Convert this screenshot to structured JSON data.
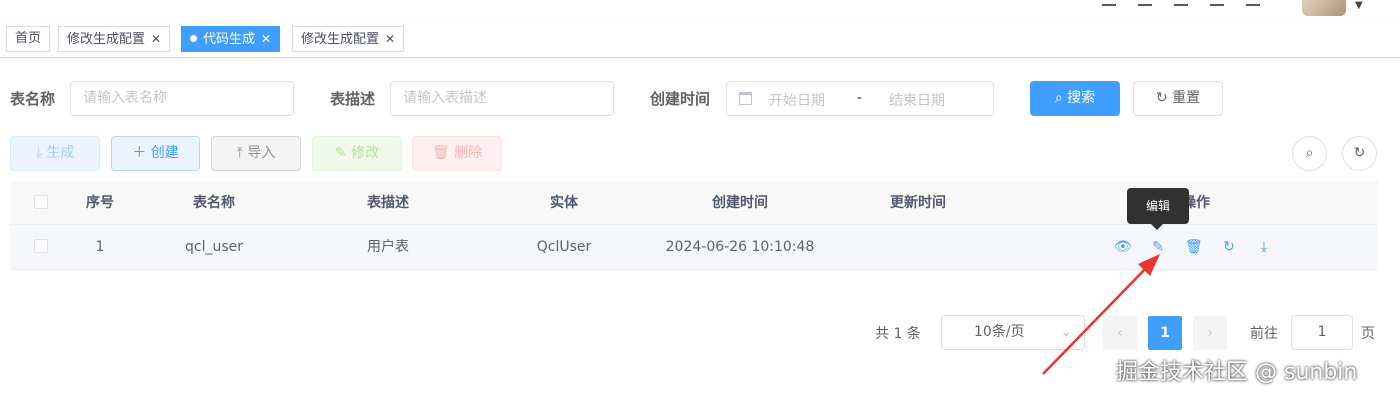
{
  "tags": [
    {
      "label": "首页",
      "closable": false,
      "active": false
    },
    {
      "label": "修改生成配置",
      "closable": true,
      "active": false
    },
    {
      "label": "代码生成",
      "closable": true,
      "active": true
    },
    {
      "label": "修改生成配置",
      "closable": true,
      "active": false
    }
  ],
  "search": {
    "table_name_label": "表名称",
    "table_name_placeholder": "请输入表名称",
    "table_desc_label": "表描述",
    "table_desc_placeholder": "请输入表描述",
    "create_time_label": "创建时间",
    "start_date_placeholder": "开始日期",
    "range_separator": "-",
    "end_date_placeholder": "结束日期",
    "search_button": "搜索",
    "reset_button": "重置"
  },
  "toolbar": {
    "generate": "生成",
    "create": "创建",
    "import": "导入",
    "edit": "修改",
    "delete": "删除"
  },
  "table": {
    "headers": [
      "序号",
      "表名称",
      "表描述",
      "实体",
      "创建时间",
      "更新时间",
      "操作"
    ],
    "rows": [
      {
        "index": "1",
        "table_name": "qcl_user",
        "table_desc": "用户表",
        "entity": "QclUser",
        "create_time": "2024-06-26 10:10:48",
        "update_time": ""
      }
    ]
  },
  "tooltip": "编辑",
  "pagination": {
    "total": "共 1 条",
    "page_size": "10条/页",
    "current_page": "1",
    "goto_label": "前往",
    "goto_value": "1",
    "goto_unit": "页"
  },
  "watermark": "掘金技术社区 @ sunbin",
  "colors": {
    "primary": "#409eff",
    "annotation_arrow": "#e8352f"
  }
}
